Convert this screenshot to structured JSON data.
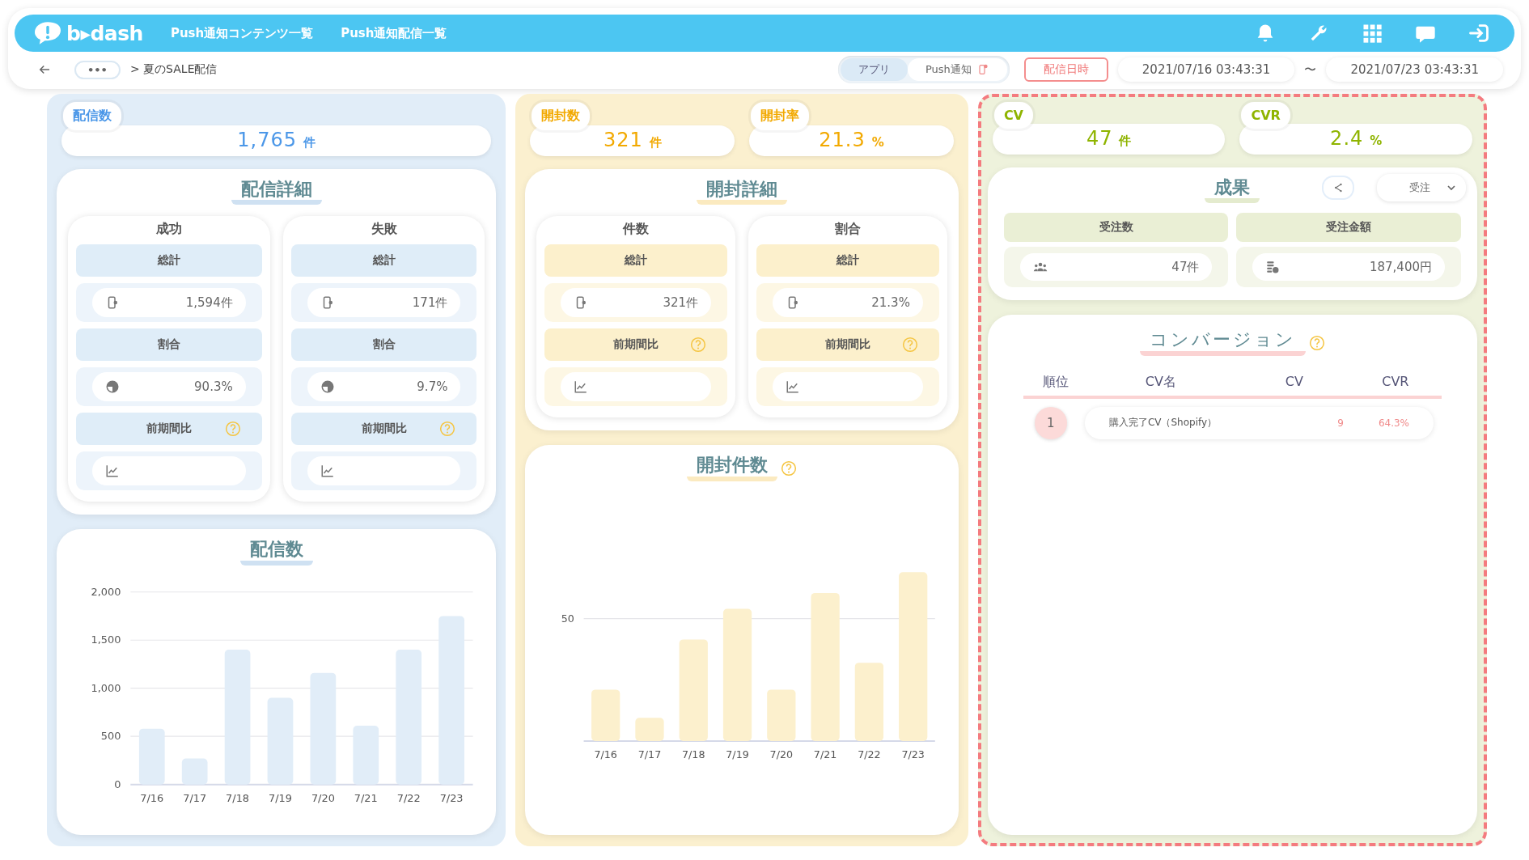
{
  "header": {
    "logo": "b▸dash",
    "nav": [
      {
        "label": "Push通知コンテンツ一覧"
      },
      {
        "label": "Push通知配信一覧"
      }
    ]
  },
  "toolbar": {
    "more": "•••",
    "breadcrumb": "> 夏のSALE配信",
    "toggle": [
      {
        "label": "アプリ",
        "selected": true
      },
      {
        "label": "Push通知",
        "selected": false
      }
    ],
    "date_label": "配信日時",
    "date_from": "2021/07/16 03:43:31",
    "separator": "〜",
    "date_to": "2021/07/23 03:43:31"
  },
  "sections": [
    {
      "highlighted": false,
      "metrics": [
        {
          "label": "配信数",
          "value": "1,765",
          "unit": "件"
        }
      ],
      "detail": {
        "title": "配信詳細",
        "groups": [
          {
            "title": "成功",
            "rows": [
              {
                "kind": "header",
                "label": "総計"
              },
              {
                "kind": "count",
                "value": "1,594件"
              },
              {
                "kind": "header",
                "label": "割合"
              },
              {
                "kind": "ratio",
                "value": "90.3%"
              },
              {
                "kind": "header",
                "label": "前期間比",
                "help": true
              },
              {
                "kind": "trend"
              }
            ]
          },
          {
            "title": "失敗",
            "rows": [
              {
                "kind": "header",
                "label": "総計"
              },
              {
                "kind": "count",
                "value": "171件"
              },
              {
                "kind": "header",
                "label": "割合"
              },
              {
                "kind": "ratio",
                "value": "9.7%"
              },
              {
                "kind": "header",
                "label": "前期間比",
                "help": true
              },
              {
                "kind": "trend"
              }
            ]
          }
        ]
      },
      "chart": {
        "title": "配信数",
        "help": false,
        "chart_data": {
          "type": "bar",
          "categories": [
            "7/16",
            "7/17",
            "7/18",
            "7/19",
            "7/20",
            "7/21",
            "7/22",
            "7/23"
          ],
          "values": [
            580,
            270,
            1400,
            900,
            1160,
            610,
            1400,
            1750
          ],
          "grid": true,
          "ylim": [
            0,
            2000
          ],
          "yticks": [
            {
              "value": 0,
              "label": "0"
            },
            {
              "value": 500,
              "label": "500"
            },
            {
              "value": 1000,
              "label": "1,000"
            },
            {
              "value": 1500,
              "label": "1,500"
            },
            {
              "value": 2000,
              "label": "2,000"
            }
          ]
        }
      }
    },
    {
      "highlighted": false,
      "metrics": [
        {
          "label": "開封数",
          "value": "321",
          "unit": "件"
        },
        {
          "label": "開封率",
          "value": "21.3",
          "unit": "%"
        }
      ],
      "detail": {
        "title": "開封詳細",
        "groups": [
          {
            "title": "件数",
            "rows": [
              {
                "kind": "header",
                "label": "総計"
              },
              {
                "kind": "count",
                "value": "321件"
              },
              {
                "kind": "header",
                "label": "前期間比",
                "help": true
              },
              {
                "kind": "trend"
              }
            ]
          },
          {
            "title": "割合",
            "rows": [
              {
                "kind": "header",
                "label": "総計"
              },
              {
                "kind": "count",
                "value": "21.3%"
              },
              {
                "kind": "header",
                "label": "前期間比",
                "help": true
              },
              {
                "kind": "trend"
              }
            ]
          }
        ]
      },
      "chart": {
        "title": "開封件数",
        "help": true,
        "tick_label": "50",
        "categories": [
          "7/16",
          "7/17",
          "7/18",
          "7/19",
          "7/20",
          "7/21",
          "7/22",
          "7/23"
        ]
      }
    },
    {
      "highlighted": true,
      "metrics": [
        {
          "label": "CV",
          "value": "47",
          "unit": "件"
        },
        {
          "label": "CVR",
          "value": "2.4",
          "unit": "%"
        }
      ],
      "results": {
        "title": "成果",
        "dropdown": "受注",
        "columns": [
          {
            "label": "受注数",
            "kind": "people",
            "value": "47件"
          },
          {
            "label": "受注金額",
            "kind": "money",
            "value": "187,400円"
          }
        ]
      },
      "conversion": {
        "title": "コンバージョン",
        "help": true,
        "columns": [
          "順位",
          "CV名",
          "CV",
          "CVR"
        ],
        "rows": [
          {
            "rank": "1",
            "name": "購入完了CV（Shopify）",
            "cv": "9",
            "cvr": "64.3%"
          }
        ]
      }
    }
  ]
}
